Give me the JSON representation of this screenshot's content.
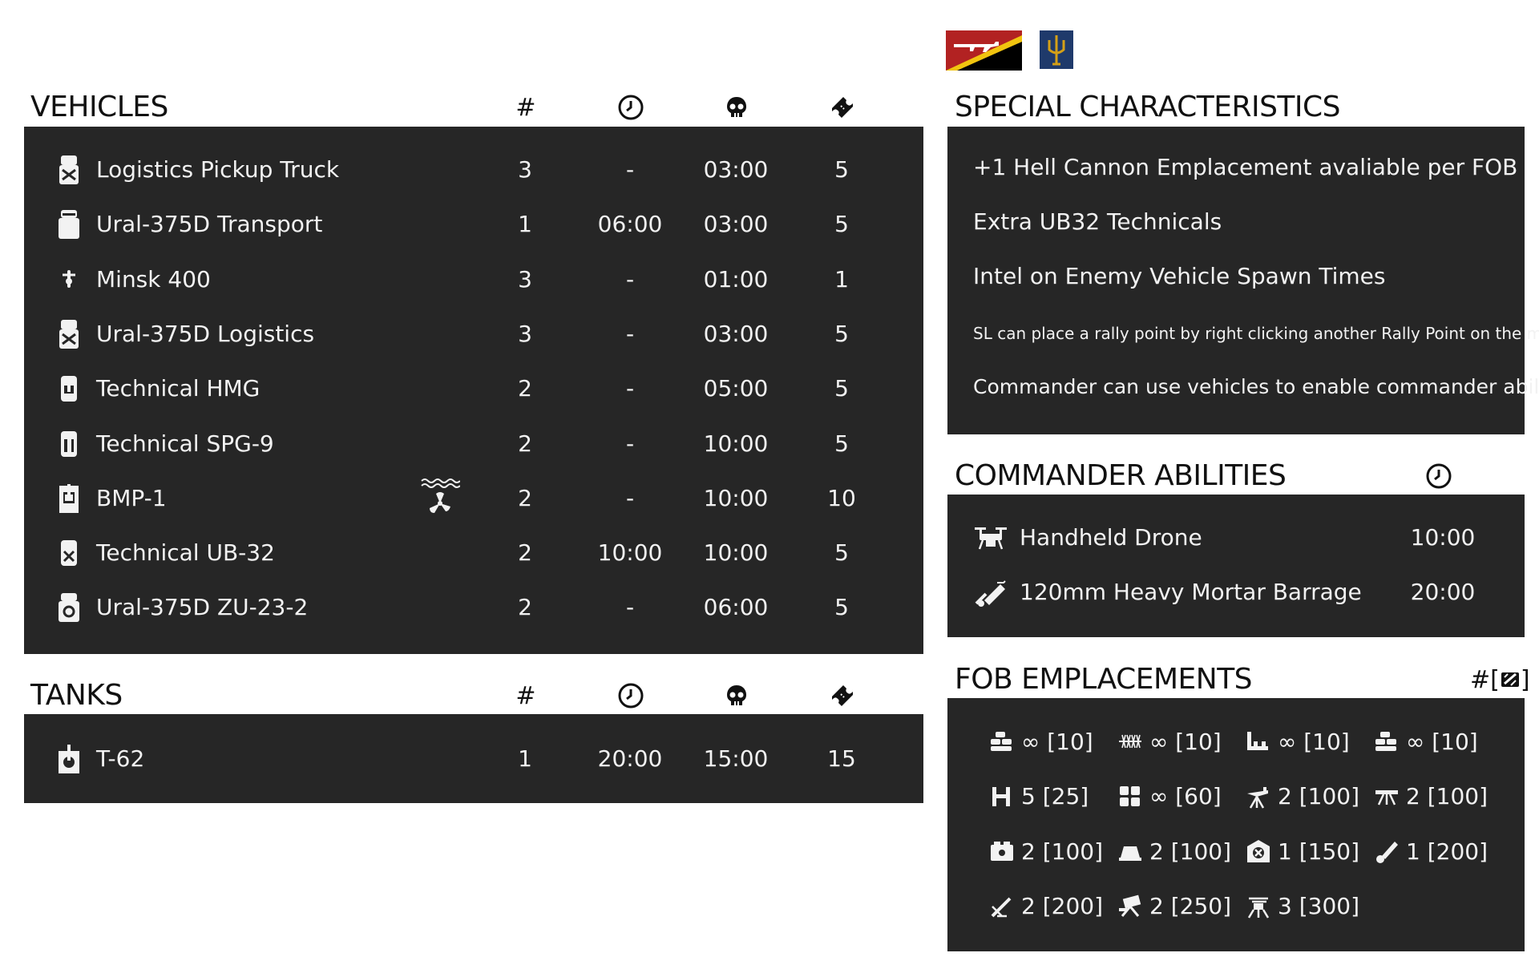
{
  "vehicles": {
    "title": "VEHICLES",
    "col_count": "#",
    "rows": [
      {
        "name": "Logistics Pickup Truck",
        "count": "3",
        "delay": "-",
        "respawn": "03:00",
        "tickets": "5",
        "icon": "truck-logistics-icon"
      },
      {
        "name": "Ural-375D Transport",
        "count": "1",
        "delay": "06:00",
        "respawn": "03:00",
        "tickets": "5",
        "icon": "truck-transport-icon"
      },
      {
        "name": "Minsk 400",
        "count": "3",
        "delay": "-",
        "respawn": "01:00",
        "tickets": "1",
        "icon": "motorcycle-icon"
      },
      {
        "name": "Ural-375D Logistics",
        "count": "3",
        "delay": "-",
        "respawn": "03:00",
        "tickets": "5",
        "icon": "truck-logistics-icon"
      },
      {
        "name": "Technical HMG",
        "count": "2",
        "delay": "-",
        "respawn": "05:00",
        "tickets": "5",
        "icon": "technical-hmg-icon"
      },
      {
        "name": "Technical SPG-9",
        "count": "2",
        "delay": "-",
        "respawn": "10:00",
        "tickets": "5",
        "icon": "technical-spg-icon"
      },
      {
        "name": "BMP-1",
        "count": "2",
        "delay": "-",
        "respawn": "10:00",
        "tickets": "10",
        "icon": "ifv-icon",
        "extra_icon": "amphibious-icon"
      },
      {
        "name": "Technical UB-32",
        "count": "2",
        "delay": "10:00",
        "respawn": "10:00",
        "tickets": "5",
        "icon": "technical-rocket-icon"
      },
      {
        "name": "Ural-375D ZU-23-2",
        "count": "2",
        "delay": "-",
        "respawn": "06:00",
        "tickets": "5",
        "icon": "truck-aa-icon"
      }
    ]
  },
  "tanks": {
    "title": "TANKS",
    "col_count": "#",
    "rows": [
      {
        "name": "T-62",
        "count": "1",
        "delay": "20:00",
        "respawn": "15:00",
        "tickets": "15",
        "icon": "tank-icon"
      }
    ]
  },
  "special": {
    "title": "SPECIAL CHARACTERISTICS",
    "items": [
      "+1 Hell Cannon Emplacement avaliable per FOB",
      "Extra UB32 Technicals",
      "Intel on Enemy Vehicle Spawn Times",
      "SL can place a rally point by right clicking another Rally Point on the map",
      "Commander can use vehicles to enable commander abilities"
    ]
  },
  "commander": {
    "title": "COMMANDER ABILITIES",
    "items": [
      {
        "name": "Handheld Drone",
        "time": "10:00",
        "icon": "drone-icon"
      },
      {
        "name": "120mm Heavy Mortar Barrage",
        "time": "20:00",
        "icon": "mortar-barrage-icon"
      }
    ]
  },
  "fob": {
    "title": "FOB EMPLACEMENTS",
    "header_label": "#[",
    "header_label_end": "]",
    "items": [
      {
        "icon": "sandbags-icon",
        "text": "∞ [10]"
      },
      {
        "icon": "razorwire-icon",
        "text": "∞ [10]"
      },
      {
        "icon": "trench-icon",
        "text": "∞ [10]"
      },
      {
        "icon": "sandbag-wall-icon",
        "text": "∞ [10]"
      },
      {
        "icon": "tank-trap-icon",
        "text": "5 [25]"
      },
      {
        "icon": "hesco-icon",
        "text": "∞ [60]"
      },
      {
        "icon": "hmg-emplacement-icon",
        "text": "2 [100]"
      },
      {
        "icon": "rifle-emplacement-icon",
        "text": "2 [100]"
      },
      {
        "icon": "ammo-crate-icon",
        "text": "2 [100]"
      },
      {
        "icon": "bunker-icon",
        "text": "2 [100]"
      },
      {
        "icon": "repair-station-icon",
        "text": "1 [150]"
      },
      {
        "icon": "mortar-icon",
        "text": "1 [200]"
      },
      {
        "icon": "hell-cannon-icon",
        "text": "2 [200]"
      },
      {
        "icon": "rocket-launcher-icon",
        "text": "2 [250]"
      },
      {
        "icon": "aa-gun-icon",
        "text": "3 [300]"
      }
    ]
  },
  "flags": {
    "faction": "militia-flag-icon",
    "subfaction": "trident-badge-icon",
    "faction_colors": [
      "#b22222",
      "#f1c40f",
      "#000000"
    ],
    "badge_color": "#1f3a6b"
  }
}
